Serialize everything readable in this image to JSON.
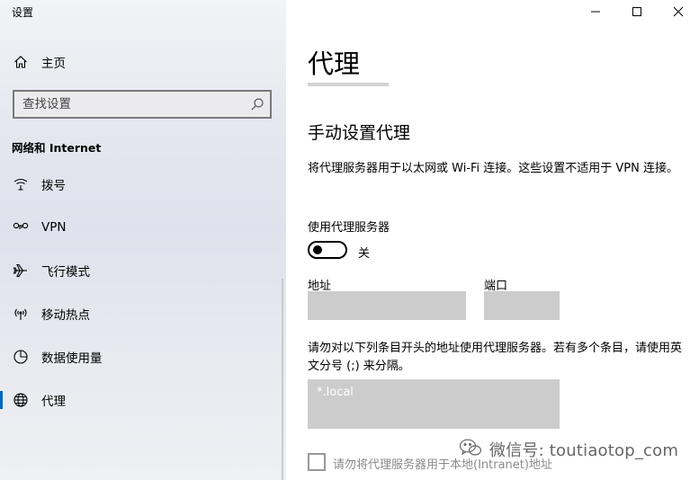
{
  "window": {
    "title": "设置",
    "controls": [
      "minimize",
      "maximize",
      "close"
    ]
  },
  "sidebar": {
    "home_label": "主页",
    "home_icon": "home-icon",
    "search": {
      "placeholder": "查找设置",
      "value": "",
      "icon": "search-icon"
    },
    "section_heading": "网络和 Internet",
    "items": [
      {
        "label": "拨号",
        "icon": "dialup-icon",
        "active": false
      },
      {
        "label": "VPN",
        "icon": "vpn-icon",
        "active": false
      },
      {
        "label": "飞行模式",
        "icon": "airplane-icon",
        "active": false
      },
      {
        "label": "移动热点",
        "icon": "hotspot-icon",
        "active": false
      },
      {
        "label": "数据使用量",
        "icon": "data-usage-icon",
        "active": false
      },
      {
        "label": "代理",
        "icon": "globe-icon",
        "active": true
      }
    ],
    "accent_color": "#0067c0"
  },
  "main": {
    "title": "代理",
    "manual_heading": "手动设置代理",
    "description": "将代理服务器用于以太网或 Wi-Fi 连接。这些设置不适用于 VPN 连接。",
    "use_proxy_label": "使用代理服务器",
    "toggle_state_label": "关",
    "toggle_on": false,
    "address_label": "地址",
    "address_value": "",
    "port_label": "端口",
    "port_value": "",
    "exceptions_description": "请勿对以下列条目开头的地址使用代理服务器。若有多个条目，请使用英文分号 (;) 来分隔。",
    "exceptions_placeholder": "*.local",
    "exceptions_value": "",
    "bypass_local_label": "请勿将代理服务器用于本地(Intranet)地址",
    "bypass_local_checked": false
  },
  "watermark": {
    "text": "微信号: toutiaotop_com",
    "icon": "wechat-icon"
  }
}
